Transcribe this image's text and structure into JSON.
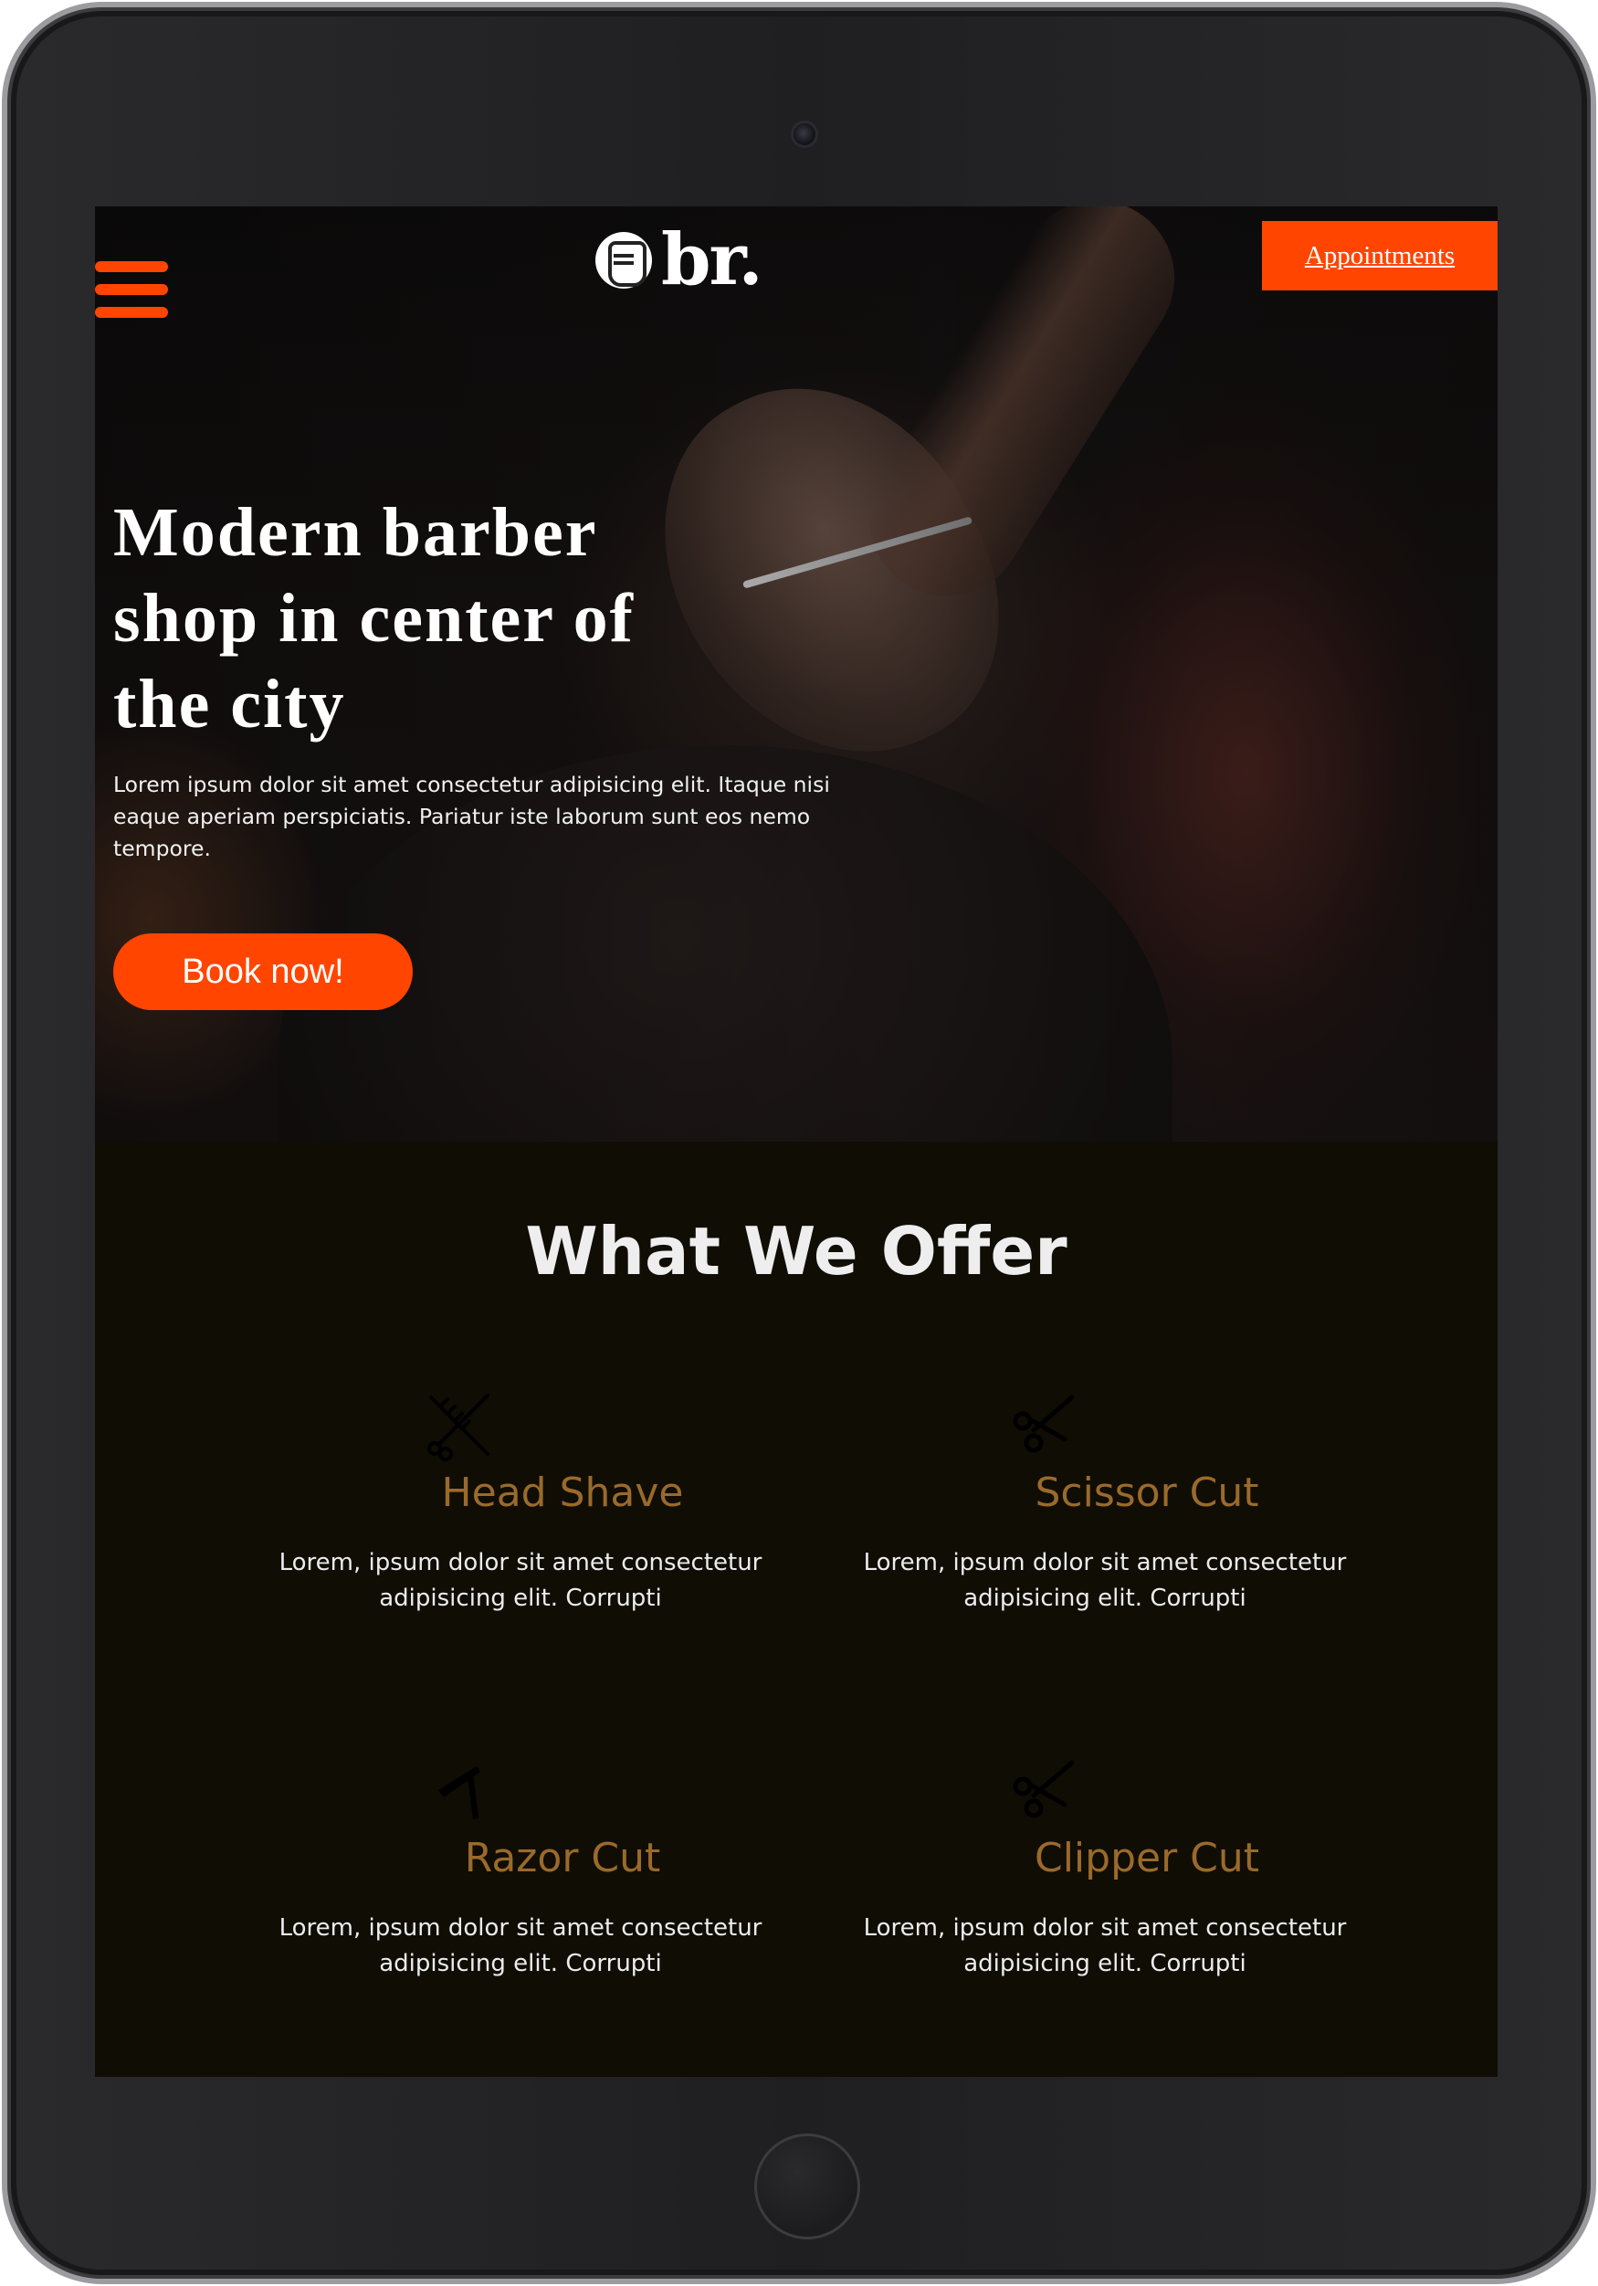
{
  "header": {
    "logo_text": "br.",
    "appointments_label": "Appointments"
  },
  "hero": {
    "title": "Modern barber shop in center of the city",
    "text": "Lorem ipsum dolor sit amet consectetur adipisicing elit. Itaque nisi eaque aperiam perspiciatis. Pariatur iste laborum sunt eos nemo tempore.",
    "cta_label": "Book now!"
  },
  "offers": {
    "title": "What We Offer",
    "items": [
      {
        "icon": "scissors-comb-icon",
        "title": "Head Shave",
        "text": "Lorem, ipsum dolor sit amet consectetur adipisicing elit. Corrupti"
      },
      {
        "icon": "scissors-icon",
        "title": "Scissor Cut",
        "text": "Lorem, ipsum dolor sit amet consectetur adipisicing elit. Corrupti"
      },
      {
        "icon": "razor-icon",
        "title": "Razor Cut",
        "text": "Lorem, ipsum dolor sit amet consectetur adipisicing elit. Corrupti"
      },
      {
        "icon": "scissors-icon",
        "title": "Clipper Cut",
        "text": "Lorem, ipsum dolor sit amet consectetur adipisicing elit. Corrupti"
      }
    ]
  },
  "colors": {
    "accent": "#ff4500",
    "offer_title": "#9a6a2b",
    "offers_background": "#100d05"
  }
}
